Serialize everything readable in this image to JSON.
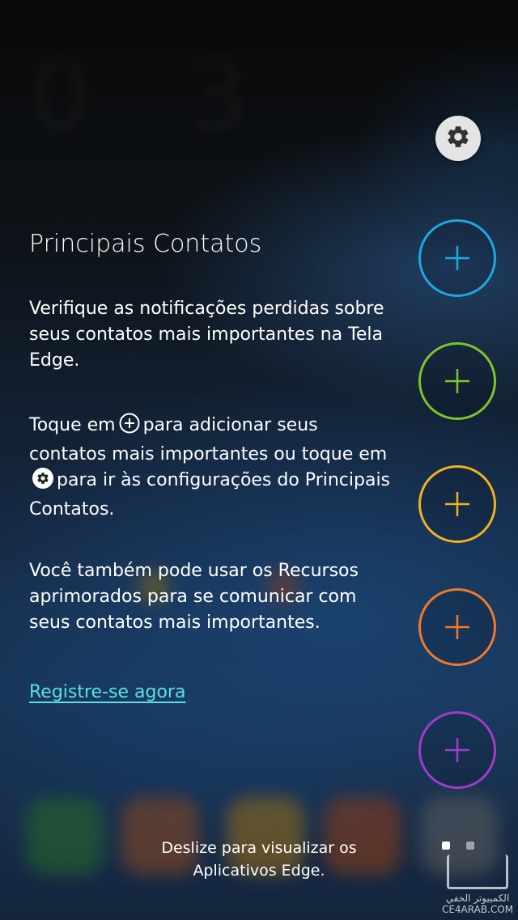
{
  "panel": {
    "title": "Principais Contatos",
    "para1": "Verifique as notificações perdidas sobre seus contatos mais importantes na Tela Edge.",
    "para2_part1": "Toque em",
    "para2_part2": "para adicionar seus contatos mais importantes ou toque em",
    "para2_part3": "para ir às configurações do Principais Contatos.",
    "para3": "Você também pode usar os Recursos aprimorados para se comunicar com seus contatos mais importantes.",
    "register_link": "Registre-se agora"
  },
  "edge": {
    "settings_icon": "gear-icon",
    "slots": [
      {
        "icon": "plus-icon",
        "color": "#1fa8e0"
      },
      {
        "icon": "plus-icon",
        "color": "#7cc52a"
      },
      {
        "icon": "plus-icon",
        "color": "#f0b21e"
      },
      {
        "icon": "plus-icon",
        "color": "#ef7a2c"
      },
      {
        "icon": "plus-icon",
        "color": "#a03cc8"
      }
    ]
  },
  "footer": {
    "hint": "Deslize para visualizar os Aplicativos Edge."
  },
  "watermark": {
    "text": "الكمبيوتر الخفي",
    "site": "CE4ARAB.COM"
  }
}
